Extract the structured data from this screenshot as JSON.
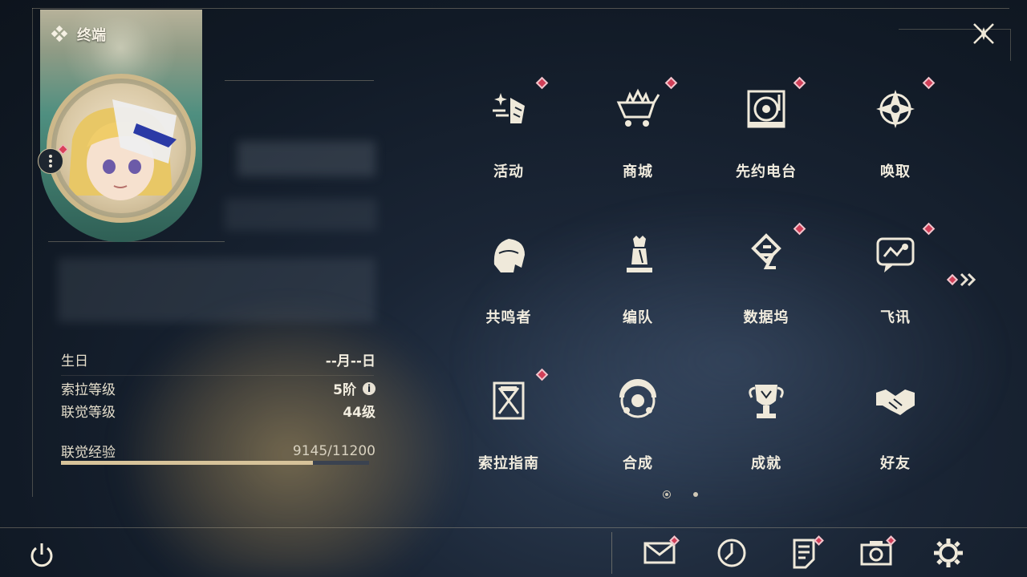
{
  "card": {
    "title": "终端"
  },
  "profile": {
    "birthday_label": "生日",
    "birthday_value": "--月--日",
    "sola_level_label": "索拉等级",
    "sola_level_value": "5阶",
    "union_level_label": "联觉等级",
    "union_level_value": "44级",
    "union_exp_label": "联觉经验",
    "union_exp_value": "9145/11200",
    "union_exp_progress": 0.8165
  },
  "menu": [
    {
      "id": "events",
      "label": "活动",
      "icon": "sparkle-flag-icon",
      "badge": true
    },
    {
      "id": "shop",
      "label": "商城",
      "icon": "crown-cart-icon",
      "badge": true
    },
    {
      "id": "radio",
      "label": "先约电台",
      "icon": "record-player-icon",
      "badge": true
    },
    {
      "id": "convene",
      "label": "唤取",
      "icon": "compass-star-icon",
      "badge": true
    },
    {
      "id": "resonators",
      "label": "共鸣者",
      "icon": "character-profile-icon",
      "badge": false
    },
    {
      "id": "team",
      "label": "编队",
      "icon": "chess-pieces-icon",
      "badge": false
    },
    {
      "id": "databank",
      "label": "数据坞",
      "icon": "data-emblem-icon",
      "badge": true
    },
    {
      "id": "messages",
      "label": "飞讯",
      "icon": "chat-bubble-icon",
      "badge": true
    },
    {
      "id": "guide",
      "label": "索拉指南",
      "icon": "guide-book-icon",
      "badge": true
    },
    {
      "id": "synthesis",
      "label": "合成",
      "icon": "synthesis-ring-icon",
      "badge": false
    },
    {
      "id": "achievements",
      "label": "成就",
      "icon": "trophy-icon",
      "badge": false
    },
    {
      "id": "friends",
      "label": "好友",
      "icon": "handshake-icon",
      "badge": false
    }
  ],
  "pagination": {
    "current": 1,
    "total": 2
  },
  "bottom_bar": [
    {
      "id": "mail",
      "icon": "mail-icon",
      "badge": true
    },
    {
      "id": "clock",
      "icon": "clock-icon",
      "badge": false
    },
    {
      "id": "notes",
      "icon": "notes-icon",
      "badge": true
    },
    {
      "id": "camera",
      "icon": "camera-icon",
      "badge": true
    },
    {
      "id": "settings",
      "icon": "gear-icon",
      "badge": false
    }
  ],
  "colors": {
    "badge": "#d13f58",
    "accent_gold": "#d7c39a",
    "background": "#111a26"
  }
}
